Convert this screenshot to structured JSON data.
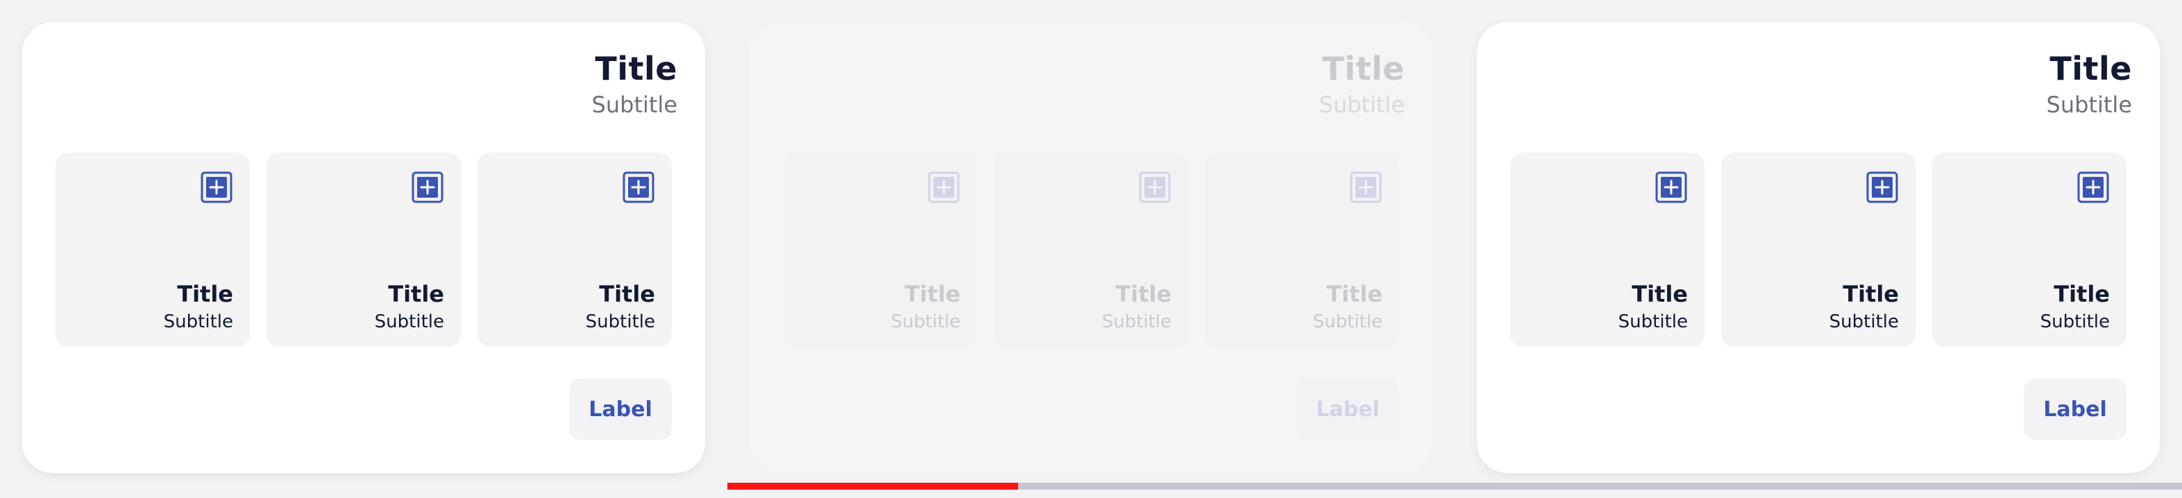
{
  "cards": [
    {
      "title": "Title",
      "subtitle": "Subtitle",
      "tiles": [
        {
          "title": "Title",
          "subtitle": "Subtitle",
          "icon": "plus-square-icon"
        },
        {
          "title": "Title",
          "subtitle": "Subtitle",
          "icon": "plus-square-icon"
        },
        {
          "title": "Title",
          "subtitle": "Subtitle",
          "icon": "plus-square-icon"
        }
      ],
      "button_label": "Label"
    },
    {
      "title": "Title",
      "subtitle": "Subtitle",
      "tiles": [
        {
          "title": "Title",
          "subtitle": "Subtitle",
          "icon": "plus-square-icon"
        },
        {
          "title": "Title",
          "subtitle": "Subtitle",
          "icon": "plus-square-icon"
        },
        {
          "title": "Title",
          "subtitle": "Subtitle",
          "icon": "plus-square-icon"
        }
      ],
      "button_label": "Label"
    },
    {
      "title": "Title",
      "subtitle": "Subtitle",
      "tiles": [
        {
          "title": "Title",
          "subtitle": "Subtitle",
          "icon": "plus-square-icon"
        },
        {
          "title": "Title",
          "subtitle": "Subtitle",
          "icon": "plus-square-icon"
        },
        {
          "title": "Title",
          "subtitle": "Subtitle",
          "icon": "plus-square-icon"
        }
      ],
      "button_label": "Label"
    }
  ],
  "carousel": {
    "progress": 0.2
  },
  "colors": {
    "accent": "#3a54b4",
    "text_dark": "#121a33",
    "text_muted": "#6b7080",
    "tile_bg": "#f3f3f3",
    "progress_fill": "#ff1414",
    "progress_track": "#c6c6ce"
  }
}
